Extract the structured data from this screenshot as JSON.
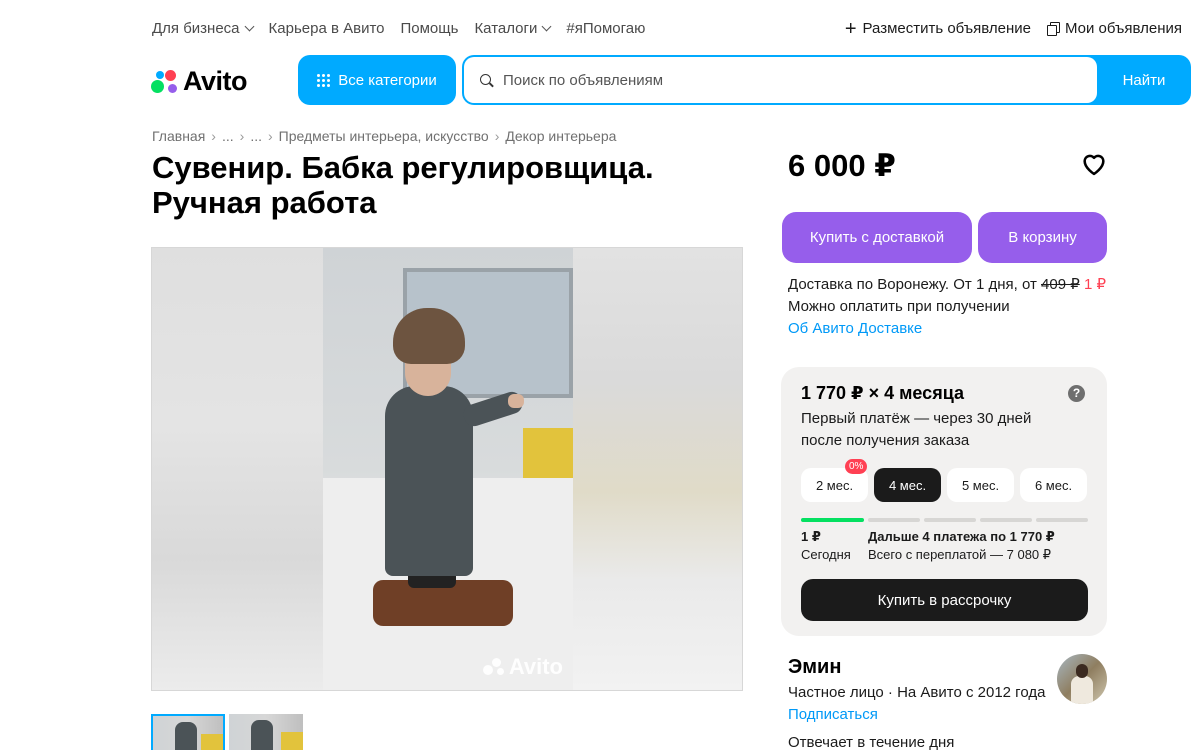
{
  "top_nav": {
    "items": [
      {
        "label": "Для бизнеса",
        "has_dropdown": true
      },
      {
        "label": "Карьера в Авито",
        "has_dropdown": false
      },
      {
        "label": "Помощь",
        "has_dropdown": false
      },
      {
        "label": "Каталоги",
        "has_dropdown": true
      },
      {
        "label": "#яПомогаю",
        "has_dropdown": false
      }
    ],
    "post_ad": "Разместить объявление",
    "my_ads": "Мои объявления"
  },
  "header": {
    "logo_text": "Avito",
    "categories_label": "Все категории",
    "search_placeholder": "Поиск по объявлениям",
    "search_button": "Найти"
  },
  "breadcrumb": [
    "Главная",
    "...",
    "...",
    "Предметы интерьера, искусство",
    "Декор интерьера"
  ],
  "listing": {
    "title": "Сувенир. Бабка регулировщица. Ручная работа",
    "price": "6 000 ₽",
    "watermark": "Avito",
    "thumbnail_count": 2
  },
  "actions": {
    "buy_delivery": "Купить с доставкой",
    "add_to_cart": "В корзину"
  },
  "delivery": {
    "line1_prefix": "Доставка по Воронежу. От 1 дня, от",
    "old_price": "409 ₽",
    "new_price": "1 ₽",
    "line2": "Можно оплатить при получении",
    "link": "Об Авито Доставке"
  },
  "installment": {
    "title": "1 770 ₽ × 4 месяца",
    "subtitle": "Первый платёж — через 30 дней после получения заказа",
    "help_icon": "?",
    "terms": [
      {
        "label": "2 мес.",
        "badge": "0%",
        "active": false
      },
      {
        "label": "4 мес.",
        "badge": "",
        "active": true
      },
      {
        "label": "5 мес.",
        "badge": "",
        "active": false
      },
      {
        "label": "6 мес.",
        "badge": "",
        "active": false
      }
    ],
    "first_amount": "1 ₽",
    "first_when": "Сегодня",
    "next_payments": "Дальше 4 платежа по 1 770 ₽",
    "total_overpay": "Всего с переплатой — 7 080 ₽",
    "button": "Купить в рассрочку",
    "progress_done_segments": 1,
    "progress_total_segments": 5
  },
  "seller": {
    "name": "Эмин",
    "info": "Частное лицо · На Авито с 2012 года",
    "subscribe": "Подписаться",
    "responds": "Отвечает в течение дня"
  },
  "colors": {
    "accent_blue": "#00aaff",
    "purple": "#965eeb",
    "link_blue": "#0099f7",
    "green": "#04e061",
    "red": "#ff4053"
  }
}
